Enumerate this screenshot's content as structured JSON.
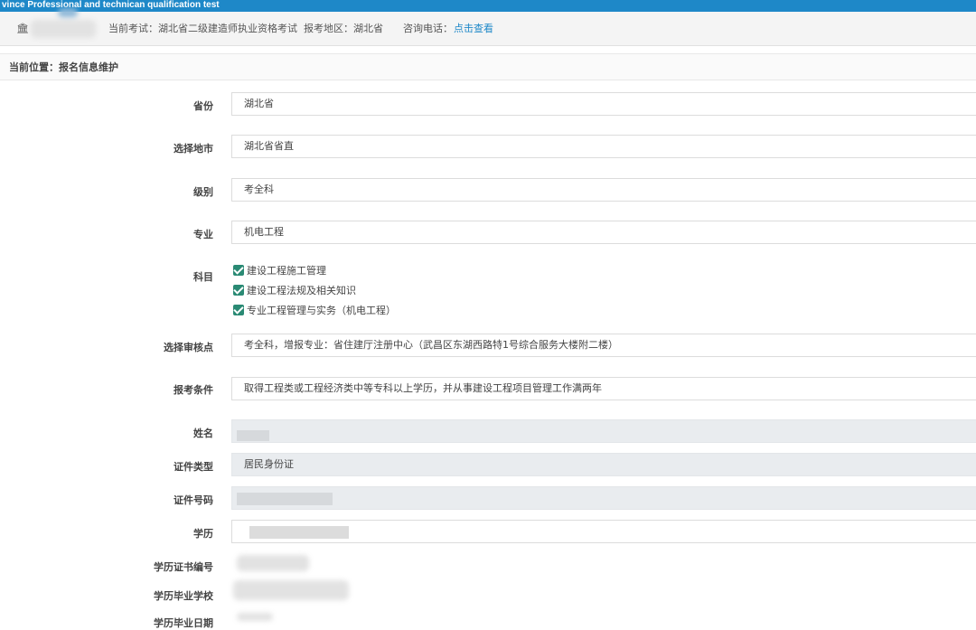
{
  "topbar": {
    "title": "vince Professional and technican qualification test"
  },
  "infobar": {
    "current_exam": "当前考试：湖北省二级建造师执业资格考试",
    "region": "报考地区：湖北省",
    "phone_label": "咨询电话：",
    "phone_link": "点击查看"
  },
  "breadcrumb": {
    "text": "当前位置：报名信息维护"
  },
  "form": {
    "province": {
      "label": "省份",
      "value": "湖北省"
    },
    "city": {
      "label": "选择地市",
      "value": "湖北省省直"
    },
    "level": {
      "label": "级别",
      "value": "考全科"
    },
    "major": {
      "label": "专业",
      "value": "机电工程"
    },
    "subjects": {
      "label": "科目",
      "items": [
        "建设工程施工管理",
        "建设工程法规及相关知识",
        "专业工程管理与实务（机电工程）"
      ]
    },
    "review_point": {
      "label": "选择审核点",
      "value": "考全科，增报专业：省住建厅注册中心（武昌区东湖西路特1号综合服务大楼附二楼）"
    },
    "condition": {
      "label": "报考条件",
      "value": "取得工程类或工程经济类中等专科以上学历，并从事建设工程项目管理工作满两年"
    },
    "name": {
      "label": "姓名",
      "value": ""
    },
    "id_type": {
      "label": "证件类型",
      "value": "居民身份证"
    },
    "id_number": {
      "label": "证件号码",
      "value": ""
    },
    "education": {
      "label": "学历",
      "value": ""
    },
    "diploma_no": {
      "label": "学历证书编号"
    },
    "school": {
      "label": "学历毕业学校"
    },
    "grad_date": {
      "label": "学历毕业日期"
    }
  }
}
